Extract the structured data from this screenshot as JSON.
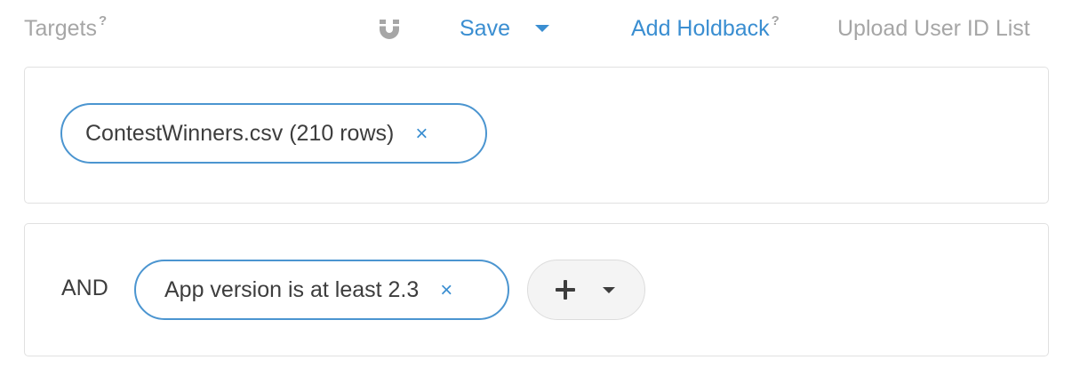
{
  "toolbar": {
    "targets_label": "Targets",
    "targets_help": "?",
    "magnet_icon": "magnet-icon",
    "save_label": "Save",
    "holdback_label": "Add Holdback",
    "holdback_help": "?",
    "upload_label": "Upload User ID List"
  },
  "panel1": {
    "chip": {
      "label": "ContestWinners.csv (210 rows)",
      "close": "×"
    }
  },
  "panel2": {
    "operator": "AND",
    "chip": {
      "label": "App version is at least 2.3",
      "close": "×"
    },
    "add_icon": "plus-icon",
    "add_caret_icon": "chevron-down-icon"
  },
  "colors": {
    "accent": "#3a8ed1",
    "muted": "#a6a6a6",
    "text": "#3d3d3d",
    "border": "#e1e1e1"
  }
}
